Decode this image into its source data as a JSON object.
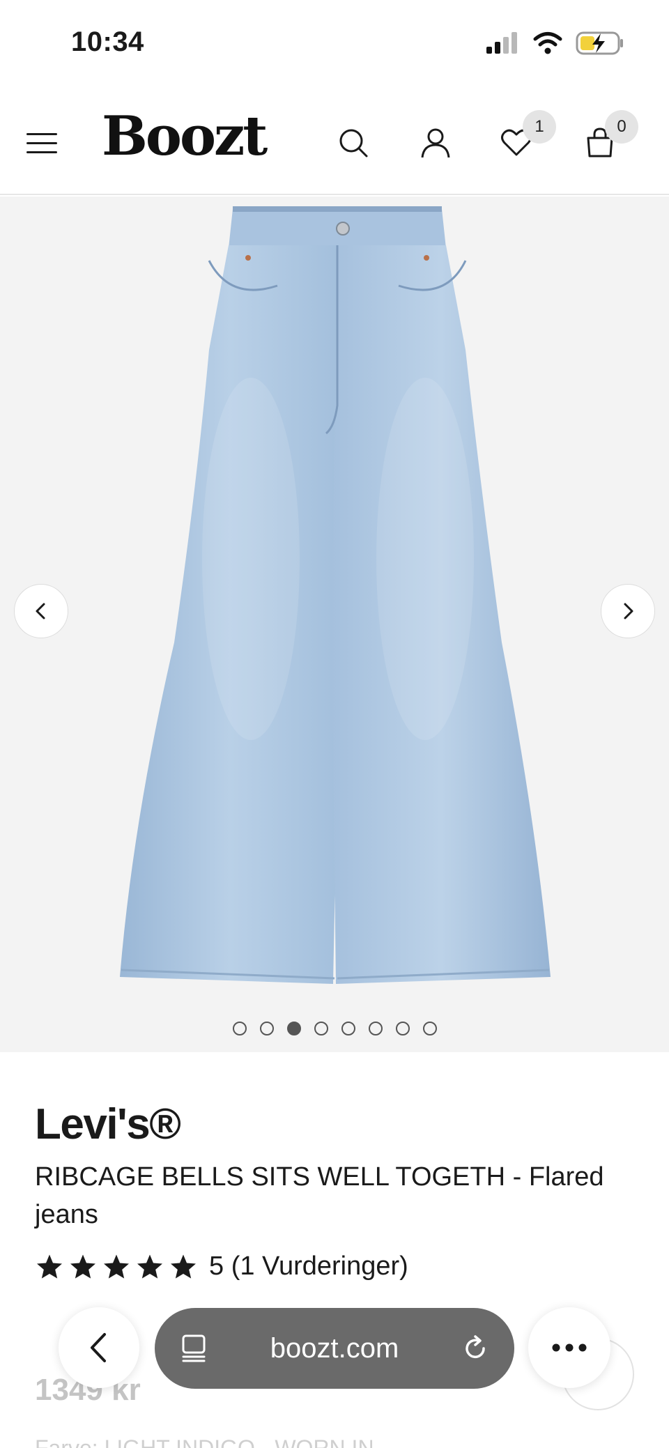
{
  "status_bar": {
    "time": "10:34",
    "icons": [
      "signal-icon",
      "wifi-icon",
      "battery-charging-icon"
    ]
  },
  "header": {
    "logo": "Boozt",
    "wishlist_count": "1",
    "cart_count": "0",
    "icons": [
      "menu-icon",
      "search-icon",
      "user-icon",
      "heart-icon",
      "bag-icon"
    ]
  },
  "gallery": {
    "image_count": 8,
    "active_index": 2
  },
  "product": {
    "brand": "Levi's®",
    "name": "RIBCAGE BELLS SITS WELL TOGETH - Flared jeans",
    "rating_stars": 5,
    "rating_text": "5 (1 Vurderinger)",
    "price": "1349 kr",
    "color_line": "Farve: LIGHT INDIGO - WORN IN"
  },
  "browser": {
    "url": "boozt.com",
    "icons": [
      "back-icon",
      "tabs-icon",
      "reload-icon",
      "more-icon"
    ]
  },
  "colors": {
    "denim": "#a9c4df",
    "gallery_bg": "#f3f3f3",
    "url_pill": "#6a6a6a"
  }
}
